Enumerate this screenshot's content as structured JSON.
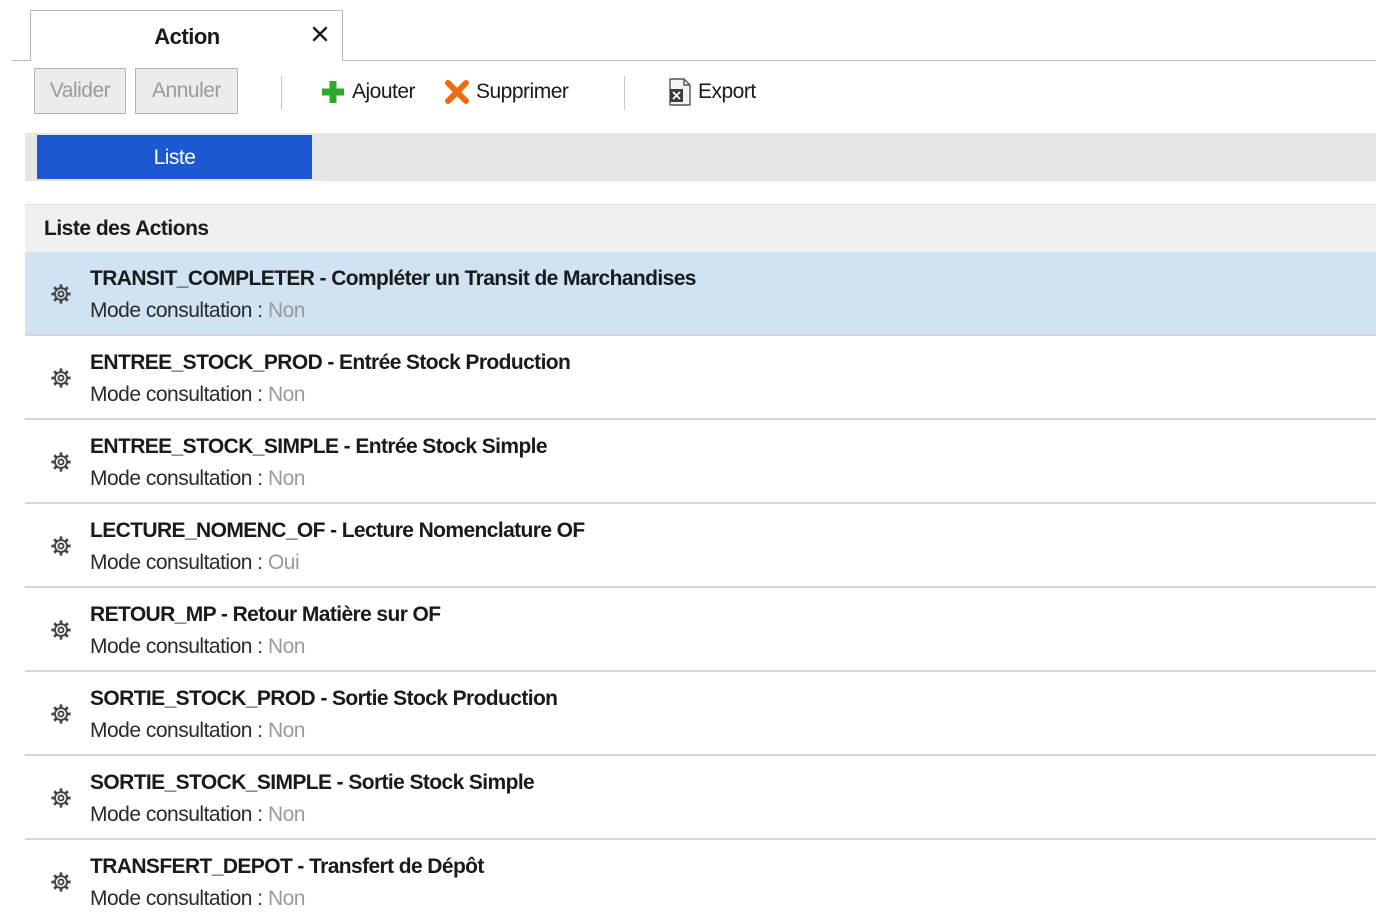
{
  "tab": {
    "label": "Action"
  },
  "toolbar": {
    "valider_label": "Valider",
    "annuler_label": "Annuler",
    "ajouter_label": "Ajouter",
    "supprimer_label": "Supprimer",
    "export_label": "Export"
  },
  "subtabs": {
    "active_label": "Liste"
  },
  "list": {
    "header": "Liste des Actions",
    "meta_label": "Mode consultation :",
    "items": [
      {
        "code": "TRANSIT_COMPLETER",
        "desc": "Compléter un Transit de Marchandises",
        "mode": "Non"
      },
      {
        "code": "ENTREE_STOCK_PROD",
        "desc": "Entrée Stock Production",
        "mode": "Non"
      },
      {
        "code": "ENTREE_STOCK_SIMPLE",
        "desc": "Entrée Stock Simple",
        "mode": "Non"
      },
      {
        "code": "LECTURE_NOMENC_OF",
        "desc": "Lecture Nomenclature OF",
        "mode": "Oui"
      },
      {
        "code": "RETOUR_MP",
        "desc": "Retour Matière sur OF",
        "mode": "Non"
      },
      {
        "code": "SORTIE_STOCK_PROD",
        "desc": "Sortie Stock Production",
        "mode": "Non"
      },
      {
        "code": "SORTIE_STOCK_SIMPLE",
        "desc": "Sortie Stock Simple",
        "mode": "Non"
      },
      {
        "code": "TRANSFERT_DEPOT",
        "desc": "Transfert de Dépôt",
        "mode": "Non"
      }
    ]
  },
  "colors": {
    "accent": "#1a59d1",
    "selected_row": "#cfe3f3",
    "add_icon": "#2fa82f",
    "delete_icon": "#ee6b10"
  },
  "icons": {
    "close": "close-icon",
    "add": "plus-icon",
    "delete": "x-icon",
    "export": "excel-file-icon",
    "row": "gear-icon"
  }
}
